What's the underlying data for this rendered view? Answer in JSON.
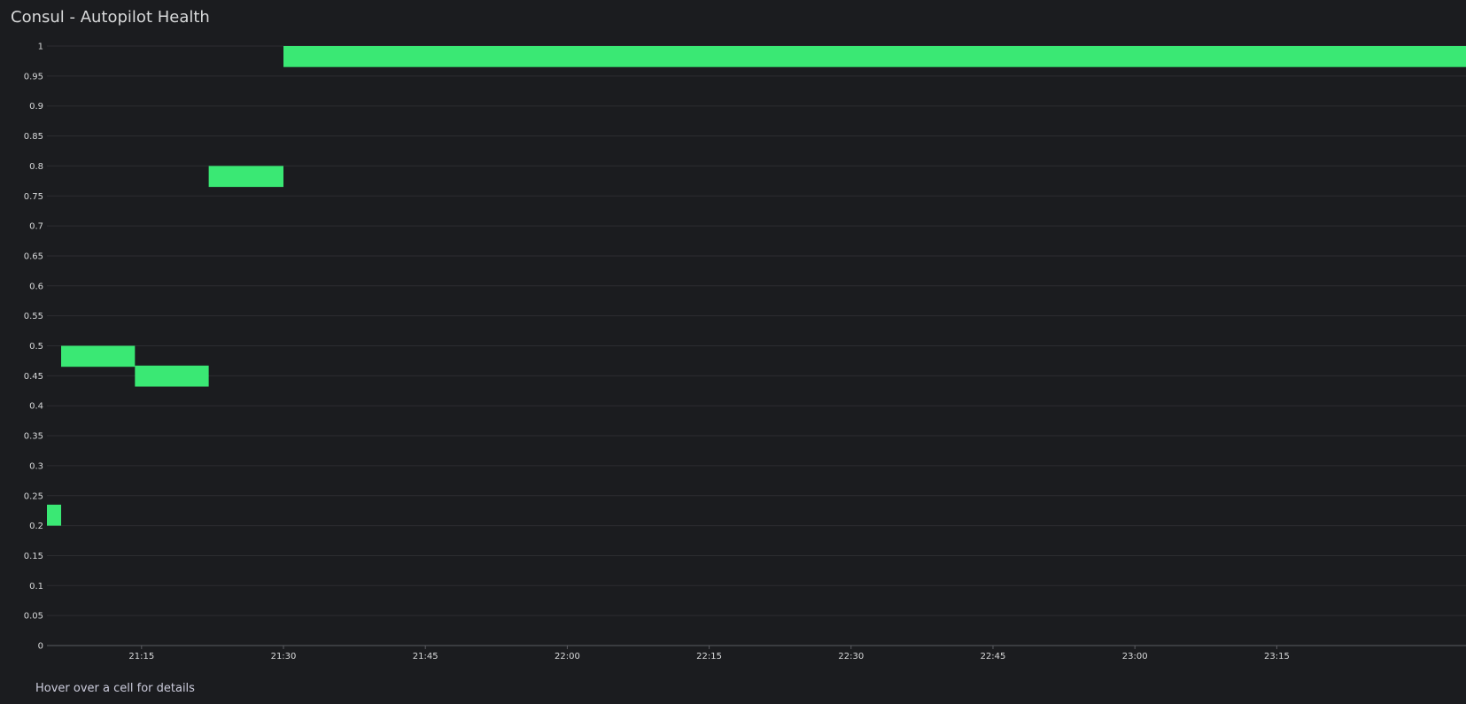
{
  "panel": {
    "title": "Consul - Autopilot Health",
    "footer_hint": "Hover over a cell for details"
  },
  "colors": {
    "background": "#1b1c1f",
    "cell": "#3ae874",
    "grid": "#2c2d31",
    "axis": "#5a5b60",
    "text": "#d8d9da"
  },
  "chart_data": {
    "type": "heatmap",
    "title": "Consul - Autopilot Health",
    "xlabel": "",
    "ylabel": "",
    "grid": true,
    "x_axis_type": "time",
    "xlim": [
      "21:05",
      "23:35"
    ],
    "ylim": [
      0,
      1
    ],
    "bucket_size": 0.035,
    "x_ticks": [
      "21:15",
      "21:30",
      "21:45",
      "22:00",
      "22:15",
      "22:30",
      "22:45",
      "23:00",
      "23:15"
    ],
    "y_ticks": [
      "0",
      "0.05",
      "0.1",
      "0.15",
      "0.2",
      "0.25",
      "0.3",
      "0.35",
      "0.4",
      "0.45",
      "0.5",
      "0.55",
      "0.6",
      "0.65",
      "0.7",
      "0.75",
      "0.8",
      "0.85",
      "0.9",
      "0.95",
      "1"
    ],
    "cells": [
      {
        "x_start": "21:05",
        "x_end": "21:06.5",
        "y_low": 0.2,
        "y_high": 0.235,
        "count": 1
      },
      {
        "x_start": "21:06.5",
        "x_end": "21:14.3",
        "y_low": 0.465,
        "y_high": 0.5,
        "count": 1
      },
      {
        "x_start": "21:14.3",
        "x_end": "21:22.1",
        "y_low": 0.432,
        "y_high": 0.467,
        "count": 1
      },
      {
        "x_start": "21:22.1",
        "x_end": "21:30",
        "y_low": 0.765,
        "y_high": 0.8,
        "count": 1
      },
      {
        "x_start": "21:30",
        "x_end": "23:35",
        "y_low": 0.965,
        "y_high": 1.0,
        "count": 1
      }
    ]
  }
}
